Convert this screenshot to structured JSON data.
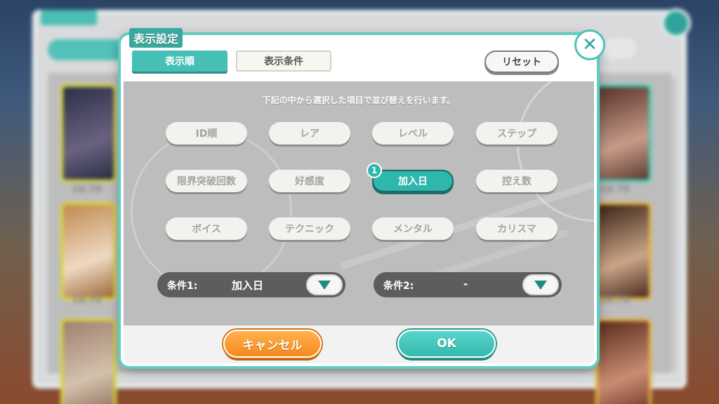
{
  "dialog": {
    "title": "表示設定",
    "tabs": [
      {
        "label": "表示順",
        "active": true
      },
      {
        "label": "表示条件",
        "active": false
      }
    ],
    "reset_label": "リセット",
    "close_icon": "close-icon",
    "instruction": "下記の中から選択した項目で並び替えを行います。",
    "sort_options": [
      {
        "label": "ID順",
        "selected": false
      },
      {
        "label": "レア",
        "selected": false
      },
      {
        "label": "レベル",
        "selected": false
      },
      {
        "label": "ステップ",
        "selected": false
      },
      {
        "label": "限界突破回数",
        "selected": false
      },
      {
        "label": "好感度",
        "selected": false
      },
      {
        "label": "加入日",
        "selected": true,
        "badge": "1"
      },
      {
        "label": "控え数",
        "selected": false
      },
      {
        "label": "ボイス",
        "selected": false
      },
      {
        "label": "テクニック",
        "selected": false
      },
      {
        "label": "メンタル",
        "selected": false
      },
      {
        "label": "カリスマ",
        "selected": false
      }
    ],
    "conditions": [
      {
        "label": "条件1:",
        "value": "加入日"
      },
      {
        "label": "条件2:",
        "value": "-"
      }
    ],
    "cancel_label": "キャンセル",
    "ok_label": "OK"
  },
  "background": {
    "level_texts": [
      "LV.70",
      "LV.70",
      "LV.70",
      "LV.70"
    ]
  },
  "colors": {
    "accent": "#46c0b6",
    "cancel": "#f4891d",
    "body": "#bdbdbd"
  }
}
